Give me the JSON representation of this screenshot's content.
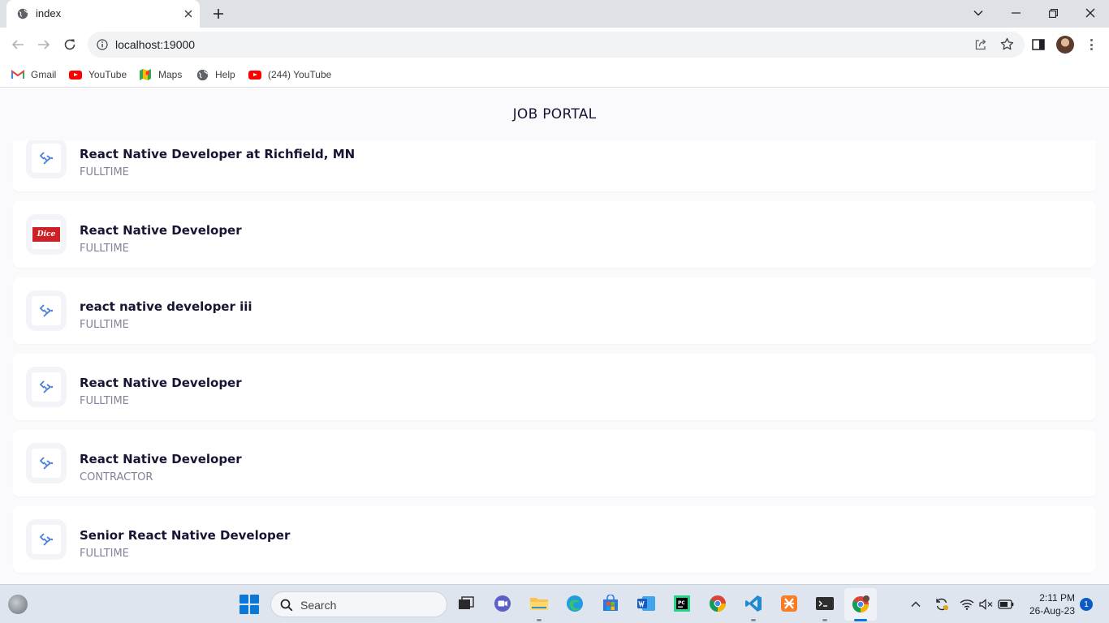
{
  "browser": {
    "tab_title": "index",
    "url": "localhost:19000",
    "bookmarks": [
      {
        "label": "Gmail",
        "icon": "gmail-icon"
      },
      {
        "label": "YouTube",
        "icon": "youtube-icon"
      },
      {
        "label": "Maps",
        "icon": "maps-icon"
      },
      {
        "label": "Help",
        "icon": "globe-icon"
      },
      {
        "label": "(244) YouTube",
        "icon": "youtube-icon"
      }
    ]
  },
  "app": {
    "title": "JOB PORTAL",
    "jobs": [
      {
        "name": "React Native Developer at Richfield, MN",
        "type": "FULLTIME",
        "logo": "placeholder-logo"
      },
      {
        "name": "React Native Developer",
        "type": "FULLTIME",
        "logo": "dice-logo",
        "logo_text": "Dice"
      },
      {
        "name": "react native developer iii",
        "type": "FULLTIME",
        "logo": "placeholder-logo"
      },
      {
        "name": "React Native Developer",
        "type": "FULLTIME",
        "logo": "placeholder-logo"
      },
      {
        "name": "React Native Developer",
        "type": "CONTRACTOR",
        "logo": "placeholder-logo"
      },
      {
        "name": "Senior React Native Developer",
        "type": "FULLTIME",
        "logo": "placeholder-logo"
      }
    ]
  },
  "taskbar": {
    "search_label": "Search",
    "time": "2:11 PM",
    "date": "26-Aug-23",
    "notification_count": "1"
  },
  "colors": {
    "accent": "#0a78d7",
    "page_background": "#fafafc",
    "title_text": "#161533",
    "type_text": "#83829a",
    "dice_red": "#cc2127"
  }
}
